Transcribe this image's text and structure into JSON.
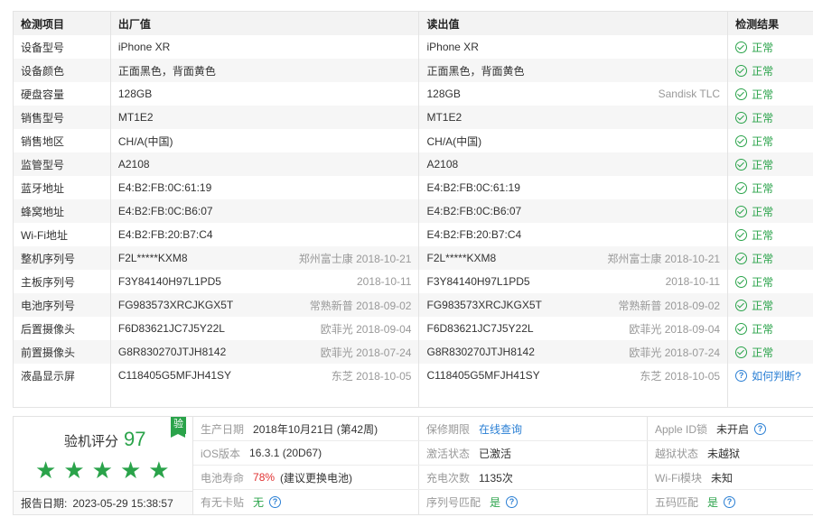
{
  "table": {
    "headers": [
      "检测项目",
      "出厂值",
      "读出值",
      "检测结果"
    ],
    "rows": [
      {
        "item": "设备型号",
        "factory": "iPhone XR",
        "factory_meta": "",
        "read": "iPhone XR",
        "read_meta": "",
        "result": "正常",
        "status": "ok"
      },
      {
        "item": "设备颜色",
        "factory": "正面黑色，背面黄色",
        "factory_meta": "",
        "read": "正面黑色，背面黄色",
        "read_meta": "",
        "result": "正常",
        "status": "ok"
      },
      {
        "item": "硬盘容量",
        "factory": "128GB",
        "factory_meta": "",
        "read": "128GB",
        "read_meta": "Sandisk TLC",
        "result": "正常",
        "status": "ok"
      },
      {
        "item": "销售型号",
        "factory": "MT1E2",
        "factory_meta": "",
        "read": "MT1E2",
        "read_meta": "",
        "result": "正常",
        "status": "ok"
      },
      {
        "item": "销售地区",
        "factory": "CH/A(中国)",
        "factory_meta": "",
        "read": "CH/A(中国)",
        "read_meta": "",
        "result": "正常",
        "status": "ok"
      },
      {
        "item": "监管型号",
        "factory": "A2108",
        "factory_meta": "",
        "read": "A2108",
        "read_meta": "",
        "result": "正常",
        "status": "ok"
      },
      {
        "item": "蓝牙地址",
        "factory": "E4:B2:FB:0C:61:19",
        "factory_meta": "",
        "read": "E4:B2:FB:0C:61:19",
        "read_meta": "",
        "result": "正常",
        "status": "ok"
      },
      {
        "item": "蜂窝地址",
        "factory": "E4:B2:FB:0C:B6:07",
        "factory_meta": "",
        "read": "E4:B2:FB:0C:B6:07",
        "read_meta": "",
        "result": "正常",
        "status": "ok"
      },
      {
        "item": "Wi-Fi地址",
        "factory": "E4:B2:FB:20:B7:C4",
        "factory_meta": "",
        "read": "E4:B2:FB:20:B7:C4",
        "read_meta": "",
        "result": "正常",
        "status": "ok"
      },
      {
        "item": "整机序列号",
        "factory": "F2L*****KXM8",
        "factory_meta": "郑州富士康 2018-10-21",
        "read": "F2L*****KXM8",
        "read_meta": "郑州富士康 2018-10-21",
        "result": "正常",
        "status": "ok"
      },
      {
        "item": "主板序列号",
        "factory": "F3Y84140H97L1PD5",
        "factory_meta": "2018-10-11",
        "read": "F3Y84140H97L1PD5",
        "read_meta": "2018-10-11",
        "result": "正常",
        "status": "ok"
      },
      {
        "item": "电池序列号",
        "factory": "FG983573XRCJKGX5T",
        "factory_meta": "常熟新普 2018-09-02",
        "read": "FG983573XRCJKGX5T",
        "read_meta": "常熟新普 2018-09-02",
        "result": "正常",
        "status": "ok"
      },
      {
        "item": "后置摄像头",
        "factory": "F6D83621JC7J5Y22L",
        "factory_meta": "欧菲光 2018-09-04",
        "read": "F6D83621JC7J5Y22L",
        "read_meta": "欧菲光 2018-09-04",
        "result": "正常",
        "status": "ok"
      },
      {
        "item": "前置摄像头",
        "factory": "G8R830270JTJH8142",
        "factory_meta": "欧菲光 2018-07-24",
        "read": "G8R830270JTJH8142",
        "read_meta": "欧菲光 2018-07-24",
        "result": "正常",
        "status": "ok"
      },
      {
        "item": "液晶显示屏",
        "factory": "C118405G5MFJH41SY",
        "factory_meta": "东芝 2018-10-05",
        "read": "C118405G5MFJH41SY",
        "read_meta": "东芝 2018-10-05",
        "result": "如何判断?",
        "status": "question"
      }
    ]
  },
  "summary": {
    "badge": "验",
    "score_label": "验机评分",
    "score": "97",
    "stars": 5,
    "report_label": "报告日期:",
    "report_date": "2023-05-29 15:38:57",
    "rows": [
      [
        {
          "label": "生产日期",
          "value": "2018年10月21日 (第42周)"
        },
        {
          "label": "保修期限",
          "value": "在线查询",
          "style": "link"
        },
        {
          "label": "Apple ID锁",
          "value": "未开启",
          "help": true
        }
      ],
      [
        {
          "label": "iOS版本",
          "value": "16.3.1 (20D67)"
        },
        {
          "label": "激活状态",
          "value": "已激活"
        },
        {
          "label": "越狱状态",
          "value": "未越狱"
        }
      ],
      [
        {
          "label": "电池寿命",
          "value": "78%",
          "style": "red",
          "extra": "(建议更换电池)"
        },
        {
          "label": "充电次数",
          "value": "1135次"
        },
        {
          "label": "Wi-Fi模块",
          "value": "未知"
        }
      ],
      [
        {
          "label": "有无卡贴",
          "value": "无",
          "style": "green",
          "help": true
        },
        {
          "label": "序列号匹配",
          "value": "是",
          "style": "green",
          "help": true
        },
        {
          "label": "五码匹配",
          "value": "是",
          "style": "green",
          "help": true
        }
      ]
    ]
  }
}
